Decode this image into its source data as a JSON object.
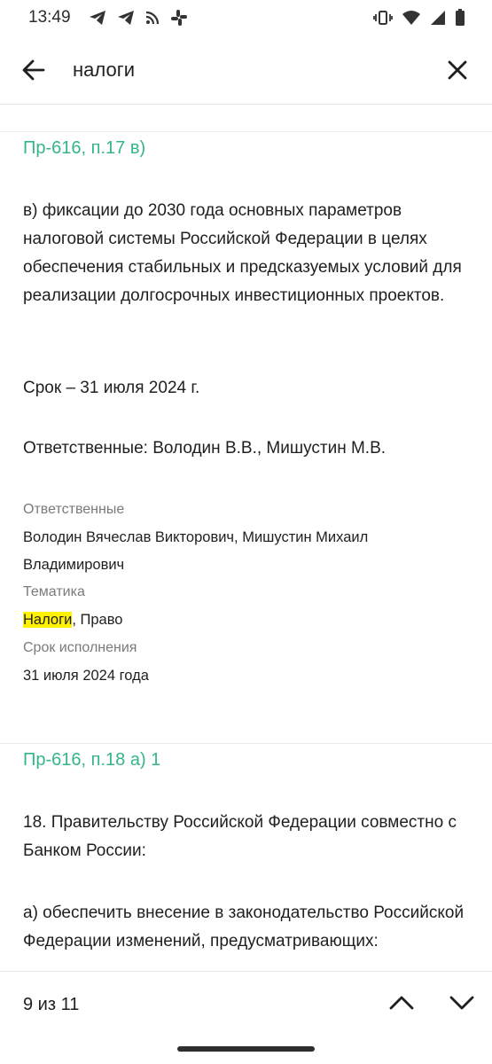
{
  "status_bar": {
    "time": "13:49",
    "left_icons": [
      "telegram-icon",
      "telegram-icon",
      "rss-icon",
      "slack-icon"
    ],
    "right_icons": [
      "vibrate-icon",
      "wifi-icon",
      "signal-icon",
      "battery-icon"
    ]
  },
  "search": {
    "query": "налоги",
    "back_icon": "arrow-left-icon",
    "close_icon": "close-icon"
  },
  "results": [
    {
      "ref": "Пр-616, п.17 в)",
      "paragraphs": [
        "в) фиксации до 2030 года основных параметров налоговой системы Российской Федерации в целях обеспечения стабильных и предсказуемых условий для реализации долгосрочных инвестиционных проектов.",
        "Срок – 31 июля 2024 г.",
        "Ответственные: Володин В.В., Мишустин М.В."
      ],
      "meta": {
        "responsible_label": "Ответственные",
        "responsible_value": "Володин Вячеслав Викторович, Мишустин Михаил Владимирович",
        "topic_label": "Тематика",
        "topic_highlight": "Налоги",
        "topic_rest": ", Право",
        "deadline_label": "Срок исполнения",
        "deadline_value": "31 июля 2024 года"
      }
    },
    {
      "ref": "Пр-616, п.18 а) 1",
      "paragraphs": [
        "18. Правительству Российской Федерации совместно с Банком России:",
        "а) обеспечить внесение в законодательство Российской Федерации изменений, предусматривающих:"
      ]
    }
  ],
  "footer": {
    "counter": "9 из 11",
    "prev_icon": "chevron-up-icon",
    "next_icon": "chevron-down-icon"
  },
  "colors": {
    "link": "#35b48c",
    "highlight": "#fff200",
    "muted": "#7a7a7a"
  }
}
